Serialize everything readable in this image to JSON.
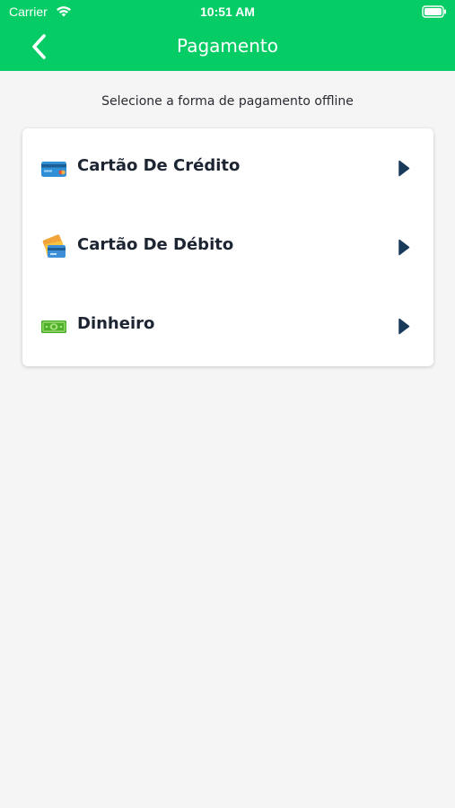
{
  "status_bar": {
    "carrier": "Carrier",
    "time": "10:51 AM"
  },
  "nav": {
    "title": "Pagamento",
    "back_icon": "chevron-left-icon"
  },
  "subtitle": "Selecione a forma de pagamento offline",
  "payment_options": [
    {
      "label": "Cartão De Crédito",
      "icon": "credit-card-icon"
    },
    {
      "label": "Cartão De Débito",
      "icon": "debit-card-icon"
    },
    {
      "label": "Dinheiro",
      "icon": "cash-icon"
    }
  ],
  "colors": {
    "header": "#06cc65",
    "background": "#f5f5f5",
    "card": "#ffffff",
    "label": "#1d2432",
    "chevron": "#1a3a5c"
  }
}
